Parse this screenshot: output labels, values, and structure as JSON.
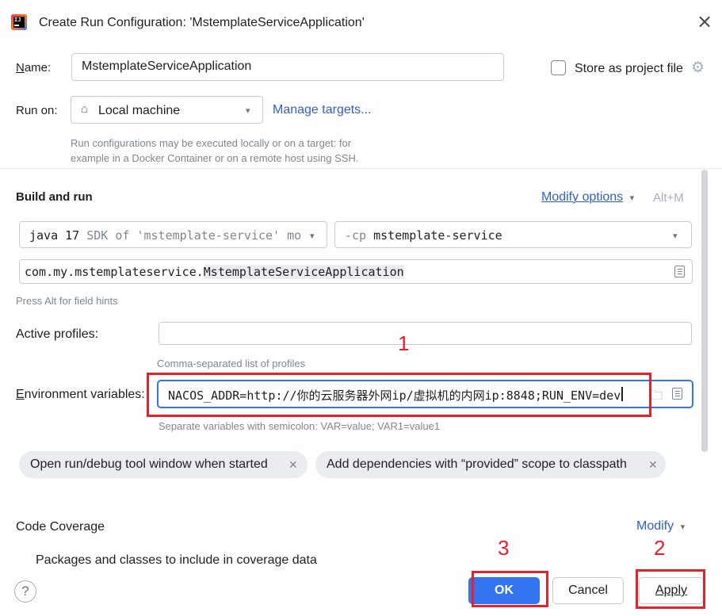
{
  "window": {
    "title": "Create Run Configuration: 'MstemplateServiceApplication'"
  },
  "name_row": {
    "label": "Name:",
    "value": "MstemplateServiceApplication",
    "store_label": "Store as project file",
    "store_checked": false
  },
  "run_on": {
    "label": "Run on:",
    "selected": "Local machine",
    "manage_link": "Manage targets...",
    "hint_line1": "Run configurations may be executed locally or on a target: for",
    "hint_line2": "example in a Docker Container or on a remote host using SSH."
  },
  "build": {
    "heading": "Build and run",
    "modify_options": "Modify options",
    "shortcut": "Alt+M",
    "jdk_bold": "java 17",
    "jdk_rest": "SDK of 'mstemplate-service' mo",
    "cp_prefix": "-cp",
    "cp_value": "mstemplate-service",
    "main_class_prefix": "com.my.mstemplateservice.",
    "main_class_name": "MstemplateServiceApplication",
    "field_hint": "Press Alt for field hints"
  },
  "profiles": {
    "label": "Active profiles:",
    "value": "",
    "hint": "Comma-separated list of profiles"
  },
  "env": {
    "label": "Environment variables:",
    "value": "NACOS_ADDR=http://你的云服务器外网ip/虚拟机的内网ip:8848;RUN_ENV=dev",
    "hint": "Separate variables with semicolon: VAR=value; VAR1=value1"
  },
  "chips": [
    {
      "label": "Open run/debug tool window when started"
    },
    {
      "label": "Add dependencies with “provided” scope to classpath"
    }
  ],
  "coverage": {
    "label": "Code Coverage",
    "modify": "Modify",
    "packages": "Packages and classes to include in coverage data"
  },
  "buttons": {
    "ok": "OK",
    "cancel": "Cancel",
    "apply": "Apply",
    "help": "?"
  },
  "annotations": {
    "marker1": "1",
    "marker2": "2",
    "marker3": "3",
    "color": "#e8202a"
  },
  "colors": {
    "accent": "#3574f0",
    "link": "#2f5fd0",
    "hint": "#818594"
  }
}
